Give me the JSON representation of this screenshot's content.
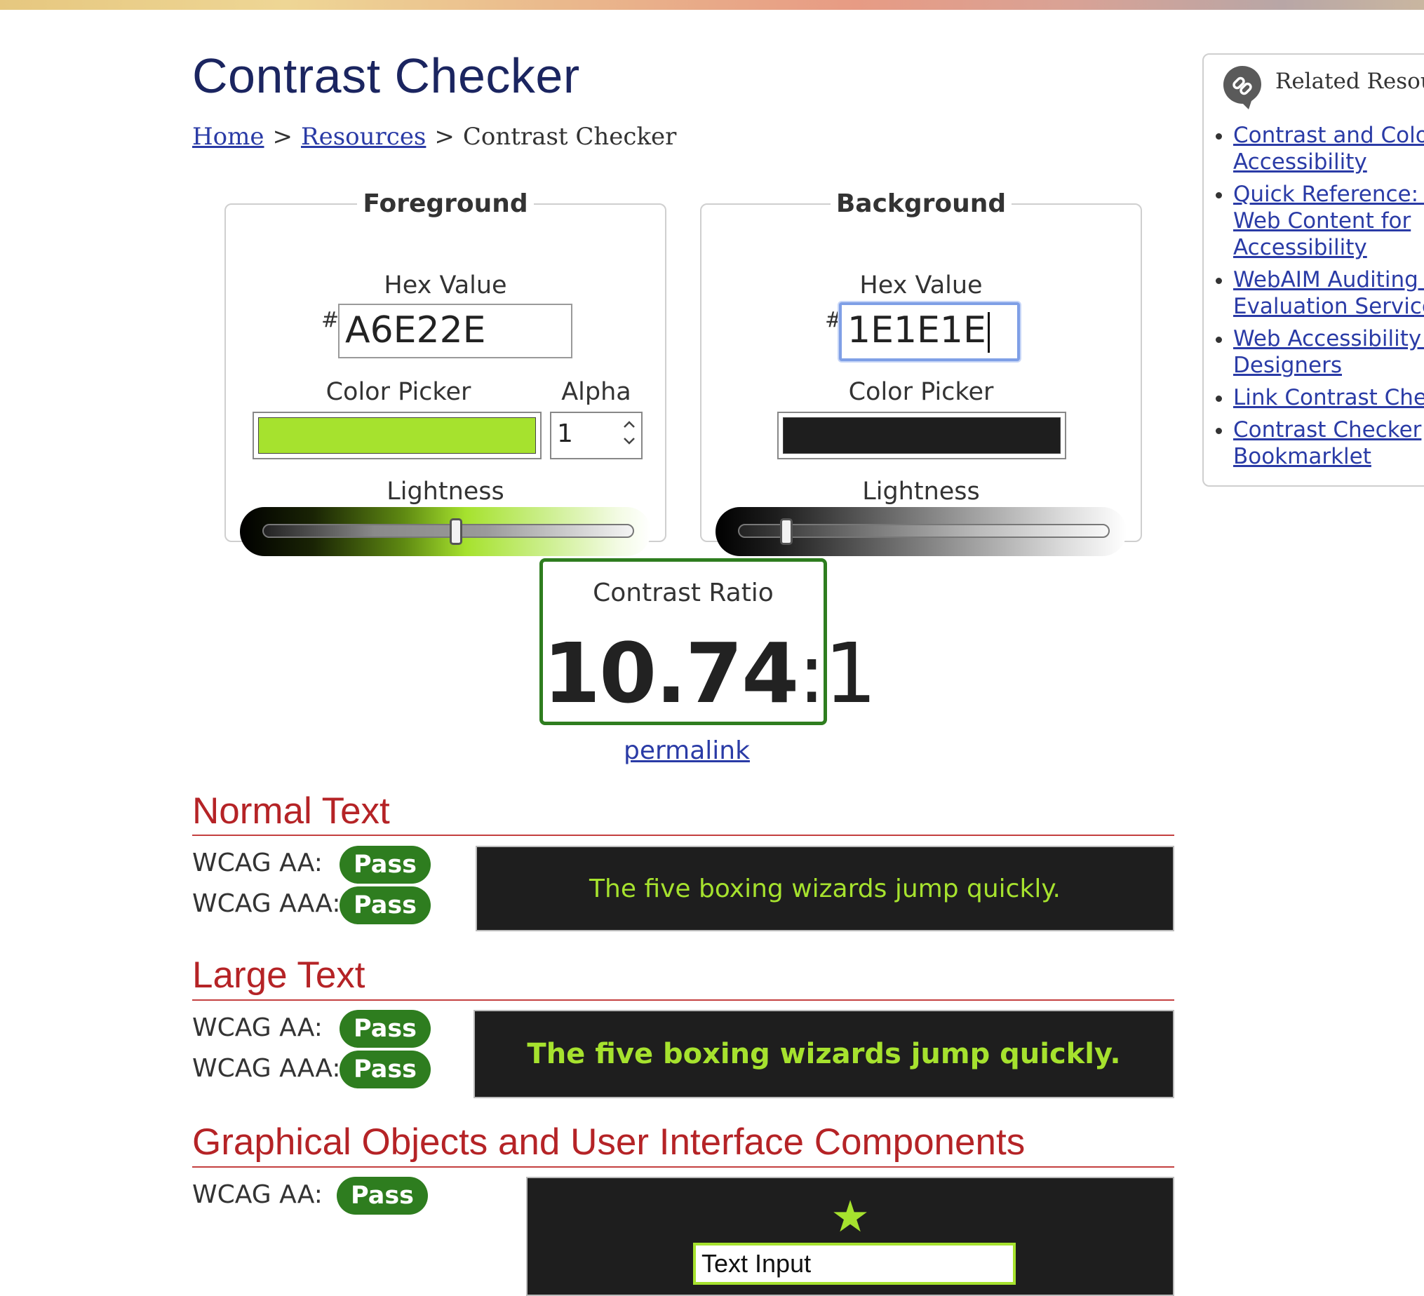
{
  "page": {
    "title": "Contrast Checker"
  },
  "breadcrumb": {
    "home": "Home",
    "sep1": ">",
    "resources": "Resources",
    "sep2": ">",
    "current": "Contrast Checker"
  },
  "foreground": {
    "legend": "Foreground",
    "hex_label": "Hex Value",
    "hash": "#",
    "hex_value": "A6E22E",
    "picker_label": "Color Picker",
    "color": "#a6e22e",
    "alpha_label": "Alpha",
    "alpha_value": "1",
    "lightness_label": "Lightness",
    "lightness_level": 0.52
  },
  "background": {
    "legend": "Background",
    "hex_label": "Hex Value",
    "hash": "#",
    "hex_value": "1E1E1E",
    "picker_label": "Color Picker",
    "color": "#1e1e1e",
    "lightness_label": "Lightness",
    "lightness_level": 0.13
  },
  "contrast": {
    "label": "Contrast Ratio",
    "ratio_main": "10.74",
    "ratio_rest": ":1",
    "permalink": "permalink"
  },
  "normal_text": {
    "heading": "Normal Text",
    "aa_label": "WCAG AA:",
    "aa_result": "Pass",
    "aaa_label": "WCAG AAA:",
    "aaa_result": "Pass",
    "sample": "The five boxing wizards jump quickly."
  },
  "large_text": {
    "heading": "Large Text",
    "aa_label": "WCAG AA:",
    "aa_result": "Pass",
    "aaa_label": "WCAG AAA:",
    "aaa_result": "Pass",
    "sample": "The five boxing wizards jump quickly."
  },
  "graphical": {
    "heading": "Graphical Objects and User Interface Components",
    "aa_label": "WCAG AA:",
    "aa_result": "Pass",
    "star_glyph": "★",
    "input_text": "Text Input"
  },
  "related": {
    "title": "Related Resou",
    "icon": "link-icon",
    "links": [
      {
        "line1": "Contrast and Color",
        "line2": "Accessibility"
      },
      {
        "line1": "Quick Reference: Te",
        "line2": "Web Content for",
        "line3": "Accessibility"
      },
      {
        "line1": "WebAIM Auditing &",
        "line2": "Evaluation Services"
      },
      {
        "line1": "Web Accessibility fo",
        "line2": "Designers"
      },
      {
        "line1": "Link Contrast Check"
      },
      {
        "line1": "Contrast Checker",
        "line2": "Bookmarklet"
      }
    ]
  },
  "colors": {
    "pass_green": "#2e7d1f",
    "heading_red": "#b52326",
    "link_blue": "#2a3ba6",
    "title_navy": "#1b2560"
  }
}
